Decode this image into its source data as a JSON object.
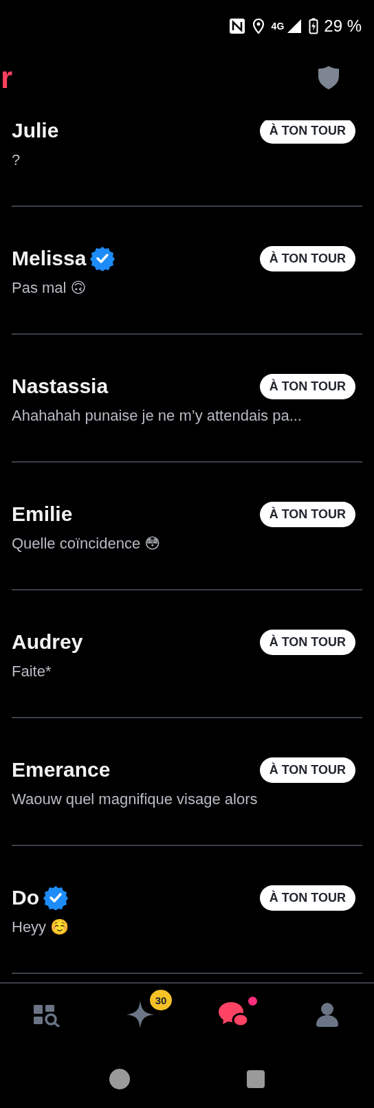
{
  "status_bar": {
    "network": "4G",
    "battery": "29 %"
  },
  "header": {
    "title": "r"
  },
  "conversations": [
    {
      "name": "Julie",
      "verified": false,
      "message": "?",
      "badge": "À TON TOUR"
    },
    {
      "name": "Melissa",
      "verified": true,
      "message": "Pas mal 🙃",
      "badge": "À TON TOUR"
    },
    {
      "name": "Nastassia",
      "verified": false,
      "message": "Ahahahah punaise je ne m’y attendais pa...",
      "badge": "À TON TOUR"
    },
    {
      "name": "Emilie",
      "verified": false,
      "message": "Quelle coïncidence 😳",
      "badge": "À TON TOUR"
    },
    {
      "name": "Audrey",
      "verified": false,
      "message": "Faite*",
      "badge": "À TON TOUR"
    },
    {
      "name": "Emerance",
      "verified": false,
      "message": "Waouw quel magnifique visage alors",
      "badge": "À TON TOUR"
    },
    {
      "name": "Do",
      "verified": true,
      "message": "Heyy ☺️",
      "badge": "À TON TOUR"
    }
  ],
  "nav": [
    {
      "kind": "explore",
      "selected": false
    },
    {
      "kind": "gold",
      "selected": false,
      "badge": "30"
    },
    {
      "kind": "messages",
      "selected": true,
      "dot": true
    },
    {
      "kind": "profile",
      "selected": false
    }
  ]
}
